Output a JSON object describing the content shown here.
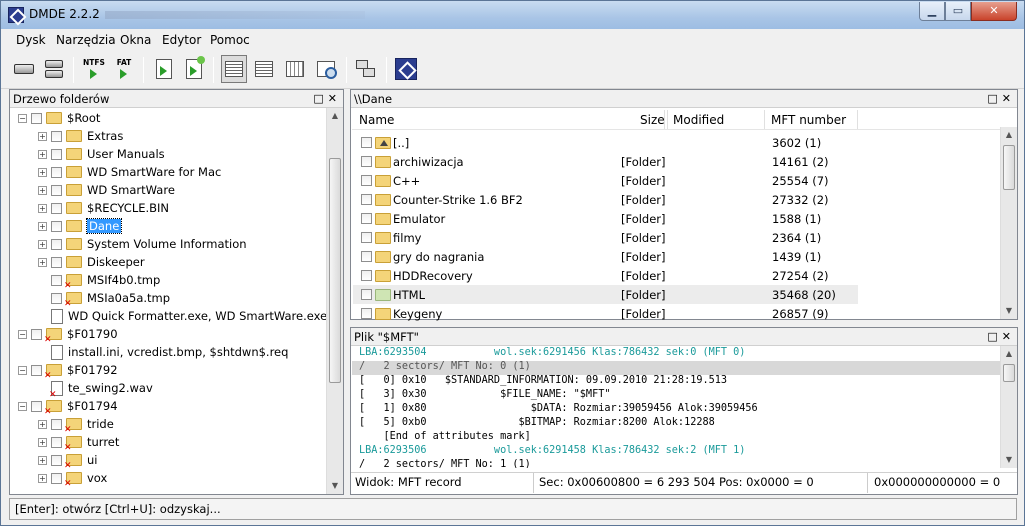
{
  "window": {
    "title": "DMDE 2.2.2",
    "blurred_path": "c:\\...\\dmde\\...\\DMDE.html"
  },
  "menu": [
    "Dysk",
    "Narzędzia",
    "Okna",
    "Edytor",
    "Pomoc"
  ],
  "toolbar": {
    "ntfs_label": "NTFS",
    "fat_label": "FAT"
  },
  "tree_panel": {
    "title": "Drzewo folderów",
    "items": [
      {
        "label": "$Root",
        "depth": 0,
        "exp": "−",
        "icon": "folder"
      },
      {
        "label": "Extras",
        "depth": 1,
        "exp": "+",
        "icon": "folder"
      },
      {
        "label": "User Manuals",
        "depth": 1,
        "exp": "+",
        "icon": "folder"
      },
      {
        "label": "WD SmartWare for Mac",
        "depth": 1,
        "exp": "+",
        "icon": "folder"
      },
      {
        "label": "WD SmartWare",
        "depth": 1,
        "exp": "+",
        "icon": "folder"
      },
      {
        "label": "$RECYCLE.BIN",
        "depth": 1,
        "exp": "+",
        "icon": "folder"
      },
      {
        "label": "Dane",
        "depth": 1,
        "exp": "+",
        "icon": "folder",
        "selected": true
      },
      {
        "label": "System Volume Information",
        "depth": 1,
        "exp": "+",
        "icon": "folder"
      },
      {
        "label": "Diskeeper",
        "depth": 1,
        "exp": "+",
        "icon": "folder"
      },
      {
        "label": "MSIf4b0.tmp",
        "depth": 1,
        "exp": "",
        "icon": "folder-del"
      },
      {
        "label": "MSIa0a5a.tmp",
        "depth": 1,
        "exp": "",
        "icon": "folder-del"
      },
      {
        "label": "WD Quick Formatter.exe, WD SmartWare.exe",
        "depth": 1,
        "exp": "",
        "icon": "files",
        "nochk": true
      },
      {
        "label": "$F01790",
        "depth": 0,
        "exp": "−",
        "icon": "folder-del"
      },
      {
        "label": "install.ini, vcredist.bmp, $shtdwn$.req",
        "depth": 1,
        "exp": "",
        "icon": "files",
        "nochk": true
      },
      {
        "label": "$F01792",
        "depth": 0,
        "exp": "−",
        "icon": "folder-del"
      },
      {
        "label": "te_swing2.wav",
        "depth": 1,
        "exp": "",
        "icon": "file-del",
        "nochk": true
      },
      {
        "label": "$F01794",
        "depth": 0,
        "exp": "−",
        "icon": "folder-del"
      },
      {
        "label": "tride",
        "depth": 1,
        "exp": "+",
        "icon": "folder-del"
      },
      {
        "label": "turret",
        "depth": 1,
        "exp": "+",
        "icon": "folder-del"
      },
      {
        "label": "ui",
        "depth": 1,
        "exp": "+",
        "icon": "folder-del"
      },
      {
        "label": "vox",
        "depth": 1,
        "exp": "+",
        "icon": "folder-del"
      }
    ]
  },
  "list_panel": {
    "title": "\\\\Dane",
    "columns": [
      "Name",
      "Size",
      "Modified",
      "MFT number"
    ],
    "rows": [
      {
        "name": "[..]",
        "size": "",
        "mft": "3602 (1)",
        "icon": "up"
      },
      {
        "name": "archiwizacja",
        "size": "[Folder]",
        "mft": "14161 (2)"
      },
      {
        "name": "C++",
        "size": "[Folder]",
        "mft": "25554 (7)"
      },
      {
        "name": "Counter-Strike 1.6 BF2",
        "size": "[Folder]",
        "mft": "27332 (2)"
      },
      {
        "name": "Emulator",
        "size": "[Folder]",
        "mft": "1588 (1)"
      },
      {
        "name": "filmy",
        "size": "[Folder]",
        "mft": "2364 (1)"
      },
      {
        "name": "gry do nagrania",
        "size": "[Folder]",
        "mft": "1439 (1)"
      },
      {
        "name": "HDDRecovery",
        "size": "[Folder]",
        "mft": "27254 (2)"
      },
      {
        "name": "HTML",
        "size": "[Folder]",
        "mft": "35468 (20)",
        "highlight": true,
        "icon": "green"
      },
      {
        "name": "Keygeny",
        "size": "[Folder]",
        "mft": "26857 (9)"
      }
    ]
  },
  "hex_panel": {
    "title": "Plik \"$MFT\"",
    "lines": [
      {
        "text": "LBA:6293504           wol.sek:6291456 Klas:786432 sek:0 (MFT 0)",
        "style": "teal"
      },
      {
        "text": "/   2 sectors/ MFT No: 0 (1)",
        "style": "gray"
      },
      {
        "text": "[   0] 0x10   $STANDARD_INFORMATION: 09.09.2010 21:28:19.513",
        "style": ""
      },
      {
        "text": "[   3] 0x30            $FILE_NAME: \"$MFT\"",
        "style": ""
      },
      {
        "text": "[   1] 0x80                 $DATA: Rozmiar:39059456 Alok:39059456",
        "style": ""
      },
      {
        "text": "[   5] 0xb0               $BITMAP: Rozmiar:8200 Alok:12288",
        "style": ""
      },
      {
        "text": "    [End of attributes mark]",
        "style": ""
      },
      {
        "text": "LBA:6293506           wol.sek:6291458 Klas:786432 sek:2 (MFT 1)",
        "style": "teal"
      },
      {
        "text": "/   2 sectors/ MFT No: 1 (1)",
        "style": ""
      }
    ]
  },
  "info": {
    "view": "Widok: MFT record",
    "sec": "Sec: 0x00600800 = 6 293 504  Pos: 0x0000 = 0",
    "offset": "0x000000000000 = 0"
  },
  "statusbar": "[Enter]: otwórz  [Ctrl+U]: odzyskaj..."
}
